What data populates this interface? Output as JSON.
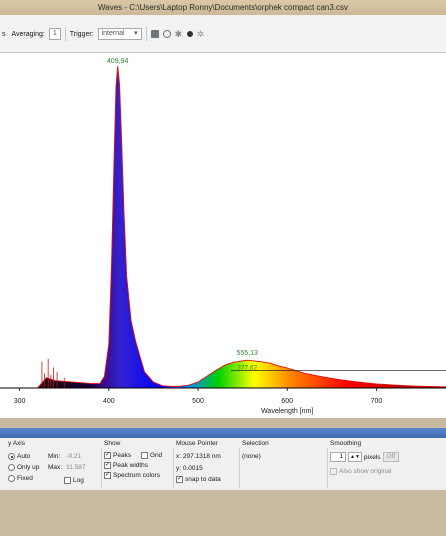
{
  "window": {
    "title": "Waves  -  C:\\Users\\Laptop Ronny\\Documents\\orphek compact can3.csv"
  },
  "toolbar": {
    "unit_suffix": "s",
    "averaging_label": "Averaging:",
    "averaging_value": "1",
    "trigger_label": "Trigger:",
    "trigger_value": "internal",
    "icons": [
      "save-icon",
      "record-icon",
      "gear-icon",
      "dot-icon",
      "settings-icon"
    ]
  },
  "chart_data": {
    "type": "line",
    "title": "",
    "xlabel": "Wavelength [nm]",
    "ylabel": "",
    "xlim": [
      278,
      778
    ],
    "ylim": [
      -0.05,
      11.587
    ],
    "x_ticks": [
      "300",
      "400",
      "500",
      "600",
      "700"
    ],
    "series": [
      {
        "x": [
          320,
          330,
          340,
          360,
          380,
          390,
          395,
          400,
          403,
          406,
          408,
          409.94,
          412,
          414,
          417,
          420,
          425,
          430,
          440,
          450,
          460,
          470,
          480,
          490,
          500,
          510,
          520,
          530,
          540,
          555.13,
          570,
          580,
          590,
          600,
          620,
          640,
          660,
          680,
          700,
          720,
          740,
          760,
          778
        ],
        "values": [
          0.0,
          0.35,
          0.25,
          0.2,
          0.15,
          0.15,
          0.4,
          1.5,
          4.2,
          8.0,
          10.3,
          11.0,
          10.4,
          8.8,
          6.0,
          3.8,
          2.3,
          1.6,
          0.55,
          0.2,
          0.08,
          0.05,
          0.06,
          0.1,
          0.2,
          0.4,
          0.6,
          0.78,
          0.88,
          0.95,
          0.9,
          0.85,
          0.76,
          0.68,
          0.5,
          0.38,
          0.28,
          0.2,
          0.14,
          0.1,
          0.07,
          0.05,
          0.04
        ]
      }
    ],
    "peak_labels": [
      "409,94",
      "555,13"
    ],
    "width_label": "377,62",
    "legend": "none",
    "grid": false,
    "spectrum_colors": true
  },
  "y_axis": {
    "title": "y Axis",
    "options": [
      "Auto",
      "Only up",
      "Fixed"
    ],
    "selected": "Auto",
    "min_label": "Min:",
    "min_value": "-0.21",
    "max_label": "Max:",
    "max_value": "11.587",
    "log_label": "Log"
  },
  "show": {
    "title": "Show",
    "peaks": "Peaks",
    "grid": "Grid",
    "peak_widths": "Peak widths",
    "spectrum_colors": "Spectrum colors"
  },
  "mouse_pointer": {
    "title": "Mouse Pointer",
    "x": "x: 297.1318 nm",
    "y": "y: 0.0015",
    "snap": "snap to data"
  },
  "selection": {
    "title": "Selection",
    "value": "(none)"
  },
  "smoothing": {
    "title": "Smoothing",
    "value": "1",
    "unit": "pixels",
    "off_button": "Off",
    "also_show_label": "Also show original"
  }
}
